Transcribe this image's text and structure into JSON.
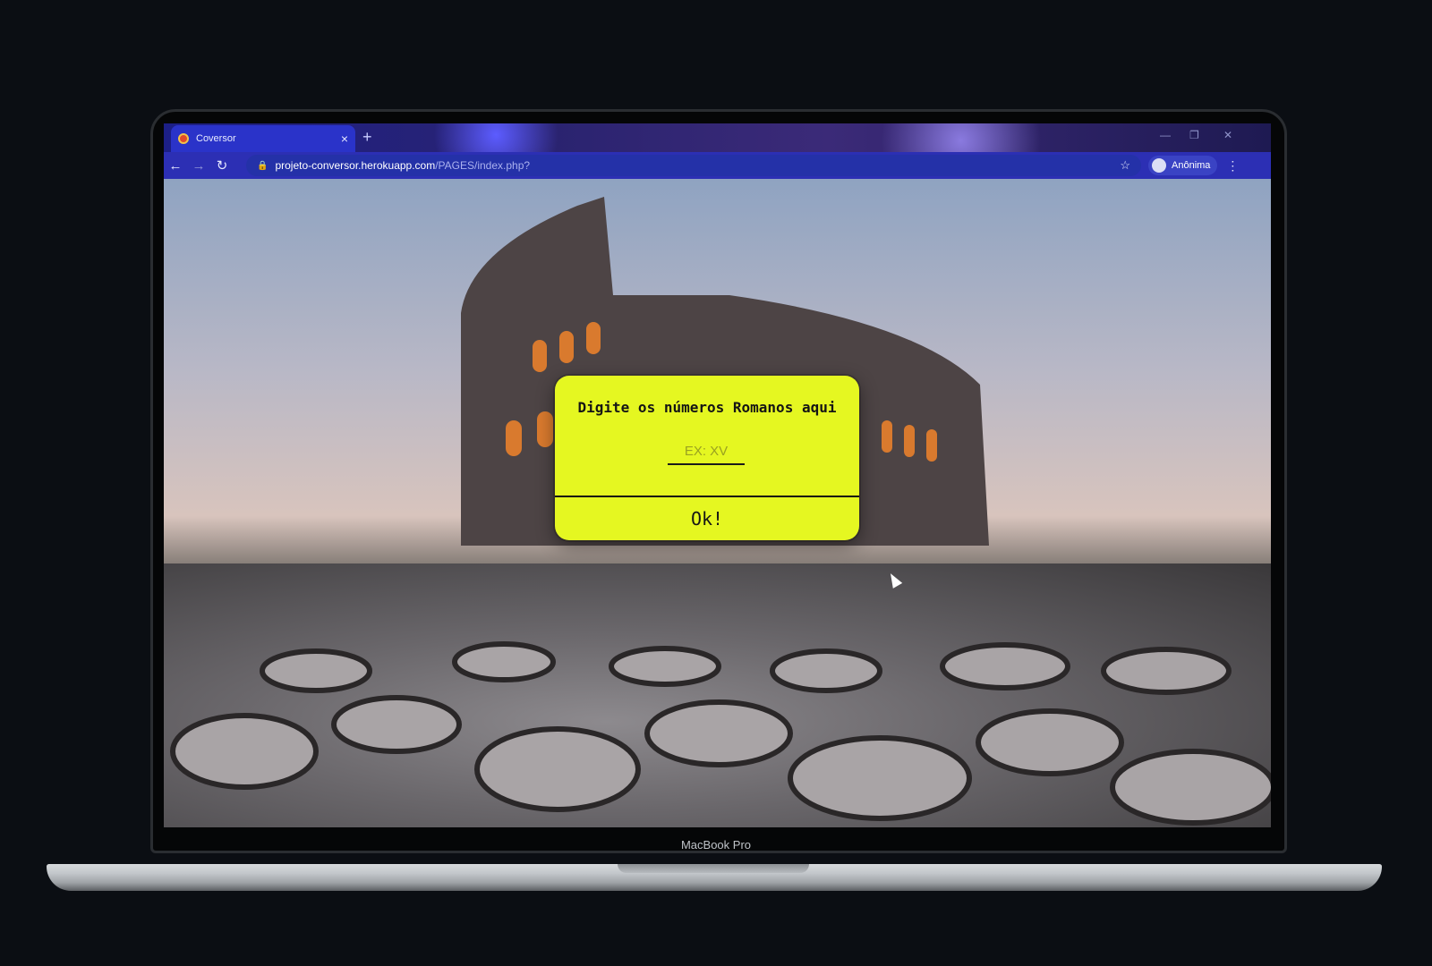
{
  "browser": {
    "tab_title": "Coversor",
    "tab_close": "×",
    "new_tab": "+",
    "url_host": "projeto-conversor.herokuapp.com",
    "url_path": "/PAGES/index.php?",
    "profile_label": "Anônima",
    "icons": {
      "back": "back-arrow-icon",
      "forward": "forward-arrow-icon",
      "reload": "reload-icon",
      "lock": "lock-icon",
      "bookmark": "star-icon",
      "menu": "kebab-menu-icon"
    }
  },
  "page": {
    "dialog_title": "Digite os números Romanos aqui",
    "input_placeholder": "EX: XV",
    "input_value": "",
    "ok_label": "Ok!"
  },
  "device": {
    "label": "MacBook Pro"
  },
  "colors": {
    "dialog_background": "#e5f721",
    "browser_chrome": "#2c2fb4"
  }
}
